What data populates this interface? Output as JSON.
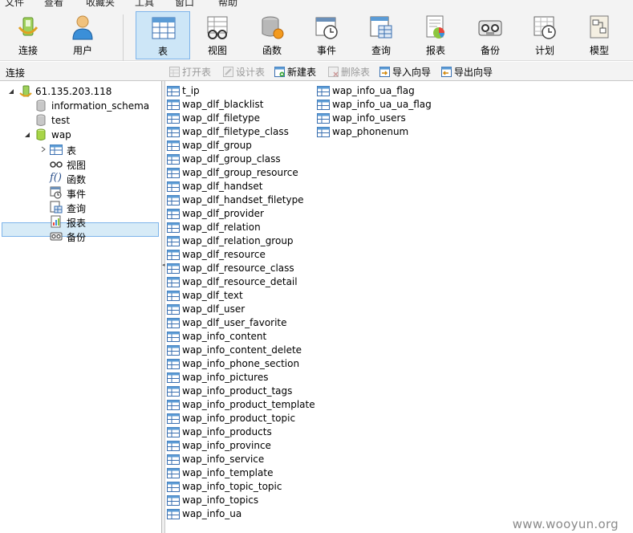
{
  "menubar": [
    "文件",
    "查看",
    "收藏夹",
    "工具",
    "窗口",
    "帮助"
  ],
  "toolbar": [
    {
      "label": "连接",
      "icon": "connection-icon"
    },
    {
      "label": "用户",
      "icon": "user-icon"
    },
    {
      "label": "表",
      "icon": "table-icon",
      "active": true
    },
    {
      "label": "视图",
      "icon": "view-icon"
    },
    {
      "label": "函数",
      "icon": "function-icon"
    },
    {
      "label": "事件",
      "icon": "event-icon"
    },
    {
      "label": "查询",
      "icon": "query-icon"
    },
    {
      "label": "报表",
      "icon": "report-icon"
    },
    {
      "label": "备份",
      "icon": "backup-icon"
    },
    {
      "label": "计划",
      "icon": "schedule-icon"
    },
    {
      "label": "模型",
      "icon": "model-icon"
    }
  ],
  "connection_panel_title": "连接",
  "object_toolbar": [
    {
      "label": "打开表",
      "icon": "open-table-icon",
      "enabled": false
    },
    {
      "label": "设计表",
      "icon": "design-table-icon",
      "enabled": false
    },
    {
      "label": "新建表",
      "icon": "new-table-icon",
      "enabled": true
    },
    {
      "label": "删除表",
      "icon": "delete-table-icon",
      "enabled": false
    },
    {
      "label": "导入向导",
      "icon": "import-wizard-icon",
      "enabled": true
    },
    {
      "label": "导出向导",
      "icon": "export-wizard-icon",
      "enabled": true
    }
  ],
  "tree": {
    "connection": "61.135.203.118",
    "databases": [
      "information_schema",
      "test",
      "wap"
    ],
    "wap_children": [
      {
        "label": "表",
        "icon": "table-icon",
        "selected": true
      },
      {
        "label": "视图",
        "icon": "view-icon"
      },
      {
        "label": "函数",
        "icon": "function-icon"
      },
      {
        "label": "事件",
        "icon": "event-icon"
      },
      {
        "label": "查询",
        "icon": "query-icon"
      },
      {
        "label": "报表",
        "icon": "report-icon"
      },
      {
        "label": "备份",
        "icon": "backup-icon"
      }
    ]
  },
  "tables_col1": [
    "t_ip",
    "wap_dlf_blacklist",
    "wap_dlf_filetype",
    "wap_dlf_filetype_class",
    "wap_dlf_group",
    "wap_dlf_group_class",
    "wap_dlf_group_resource",
    "wap_dlf_handset",
    "wap_dlf_handset_filetype",
    "wap_dlf_provider",
    "wap_dlf_relation",
    "wap_dlf_relation_group",
    "wap_dlf_resource",
    "wap_dlf_resource_class",
    "wap_dlf_resource_detail",
    "wap_dlf_text",
    "wap_dlf_user",
    "wap_dlf_user_favorite",
    "wap_info_content",
    "wap_info_content_delete",
    "wap_info_phone_section",
    "wap_info_pictures",
    "wap_info_product_tags",
    "wap_info_product_template",
    "wap_info_product_topic",
    "wap_info_products",
    "wap_info_province",
    "wap_info_service",
    "wap_info_template",
    "wap_info_topic_topic",
    "wap_info_topics",
    "wap_info_ua"
  ],
  "tables_col2": [
    "wap_info_ua_flag",
    "wap_info_ua_ua_flag",
    "wap_info_users",
    "wap_phonenum"
  ],
  "watermark": "www.wooyun.org",
  "colors": {
    "selection": "#cde6f7",
    "selection_border": "#7eb4ea",
    "toolbar_bg": "#f3f3f3"
  }
}
